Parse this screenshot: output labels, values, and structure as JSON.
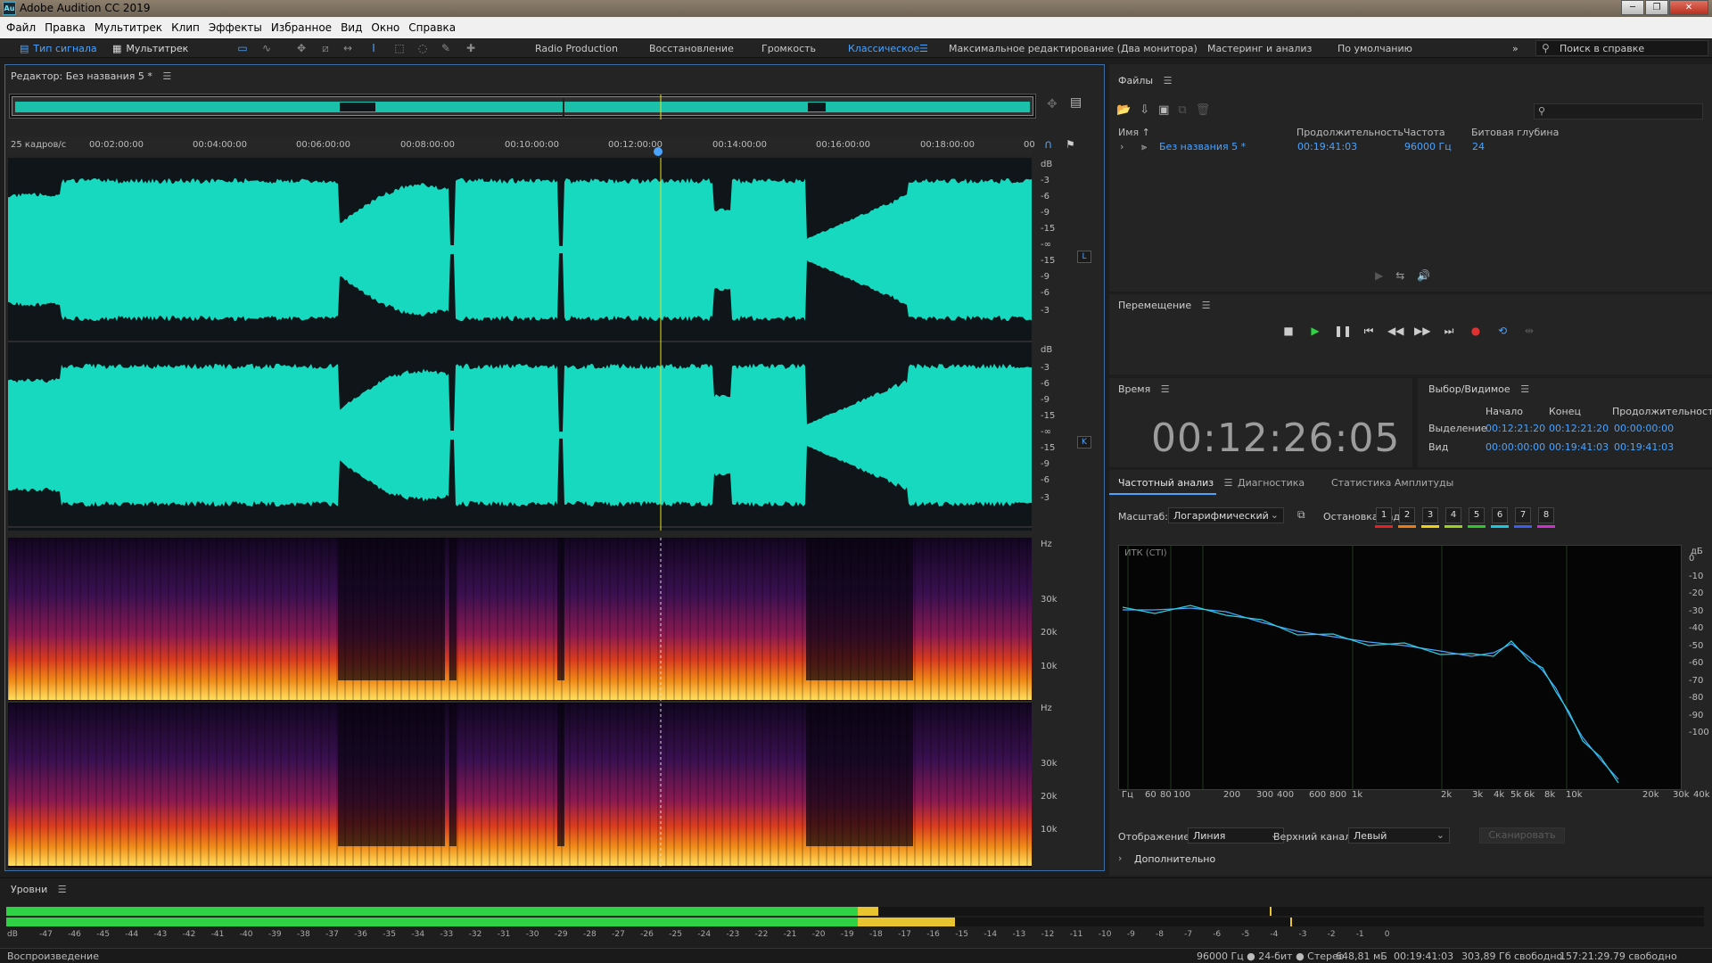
{
  "window": {
    "app_icon": "Au",
    "title": "Adobe Audition CC 2019",
    "btn_min": "─",
    "btn_max": "❐",
    "btn_close": "✕"
  },
  "menu": [
    "Файл",
    "Правка",
    "Мультитрек",
    "Клип",
    "Эффекты",
    "Избранное",
    "Вид",
    "Окно",
    "Справка"
  ],
  "toolbar": {
    "waveform_label": "Тип сигнала",
    "multitrack_label": "Мультитрек",
    "workspaces": [
      "Radio Production",
      "Восстановление",
      "Громкость",
      "Классическое",
      "Максимальное редактирование (Два монитора)",
      "Мастеринг и анализ",
      "По умолчанию"
    ],
    "active_workspace": "Классическое",
    "help_placeholder": "Поиск в справке"
  },
  "editor": {
    "title": "Редактор: Без названия 5 *",
    "ruler_unit": "25 кадров/с",
    "ruler_labels": [
      "00:02:00:00",
      "00:04:00:00",
      "00:06:00:00",
      "00:08:00:00",
      "00:10:00:00",
      "00:12:00:00",
      "00:14:00:00",
      "00:16:00:00",
      "00:18:00:00",
      "00"
    ],
    "db_labels": [
      "dB",
      "-3",
      "-6",
      "-9",
      "-15",
      "-∞",
      "-15",
      "-9",
      "-6",
      "-3"
    ],
    "hz_labels": [
      "Hz",
      "30k",
      "20k",
      "10k"
    ],
    "channel_l": "L",
    "channel_r": "K"
  },
  "files": {
    "title": "Файлы",
    "columns": [
      "Имя ↑",
      "Продолжительность",
      "Частота",
      "Битовая глубина"
    ],
    "rows": [
      {
        "name": "Без названия 5 *",
        "duration": "00:19:41:03",
        "rate": "96000 Гц",
        "depth": "24"
      }
    ]
  },
  "transport": {
    "title": "Перемещение"
  },
  "time": {
    "title": "Время",
    "value": "00:12:26:05"
  },
  "selection": {
    "title": "Выбор/Видимое",
    "headers": [
      "Начало",
      "Конец",
      "Продолжительность"
    ],
    "rows": [
      {
        "label": "Выделение",
        "start": "00:12:21:20",
        "end": "00:12:21:20",
        "duration": "00:00:00:00"
      },
      {
        "label": "Вид",
        "start": "00:00:00:00",
        "end": "00:19:41:03",
        "duration": "00:19:41:03"
      }
    ]
  },
  "frequency": {
    "tabs": [
      "Частотный анализ",
      "Диагностика",
      "Статистика Амплитуды"
    ],
    "scale_label": "Масштаб:",
    "scale_value": "Логарифмический",
    "hold_label": "Остановка кадра:",
    "frames": [
      "1",
      "2",
      "3",
      "4",
      "5",
      "6",
      "7",
      "8"
    ],
    "frame_colors": [
      "#e82020",
      "#f07a10",
      "#f0d010",
      "#9ad21a",
      "#2ac82a",
      "#18c8e0",
      "#3a5ff0",
      "#d030d0"
    ],
    "plot_label": "ИТК (CTI)",
    "x_labels": [
      "Гц",
      "60",
      "80",
      "100",
      "200",
      "300",
      "400",
      "600",
      "800",
      "1k",
      "2k",
      "3k",
      "4k",
      "5k",
      "6k",
      "8k",
      "10k",
      "20k",
      "30k",
      "40k"
    ],
    "y_labels": [
      "дБ",
      "0",
      "-10",
      "-20",
      "-30",
      "-40",
      "-50",
      "-60",
      "-70",
      "-80",
      "-90",
      "-100"
    ],
    "display_label": "Отображение:",
    "display_value": "Линия",
    "channel_label": "Верхний канал:",
    "channel_value": "Левый",
    "scan_button": "Сканировать",
    "more_label": "Дополнительно"
  },
  "levels": {
    "title": "Уровни",
    "scale": [
      "dB",
      "-47",
      "-46",
      "-45",
      "-44",
      "-43",
      "-42",
      "-41",
      "-40",
      "-39",
      "-38",
      "-37",
      "-36",
      "-35",
      "-34",
      "-33",
      "-32",
      "-31",
      "-30",
      "-29",
      "-28",
      "-27",
      "-26",
      "-25",
      "-24",
      "-23",
      "-22",
      "-21",
      "-20",
      "-19",
      "-18",
      "-17",
      "-16",
      "-15",
      "-14",
      "-13",
      "-12",
      "-11",
      "-10",
      "-9",
      "-8",
      "-7",
      "-6",
      "-5",
      "-4",
      "-3",
      "-2",
      "-1",
      "0"
    ],
    "left_db": -17.7,
    "right_db": -15.0,
    "left_peak_db": -4.0,
    "right_peak_db": -3.3
  },
  "status": {
    "left": "Воспроизведение",
    "format": "96000 Гц ● 24-бит ● Стерео",
    "size": "648,81 мБ",
    "duration": "00:19:41:03",
    "free": "303,89 Гб свободно",
    "free_time": "157:21:29.79 свободно"
  },
  "colors": {
    "accent": "#4aa3ff",
    "waveform": "#16d9c0",
    "meter_green": "#2fd244",
    "meter_yellow": "#e8c431",
    "playhead": "#e8e020"
  }
}
